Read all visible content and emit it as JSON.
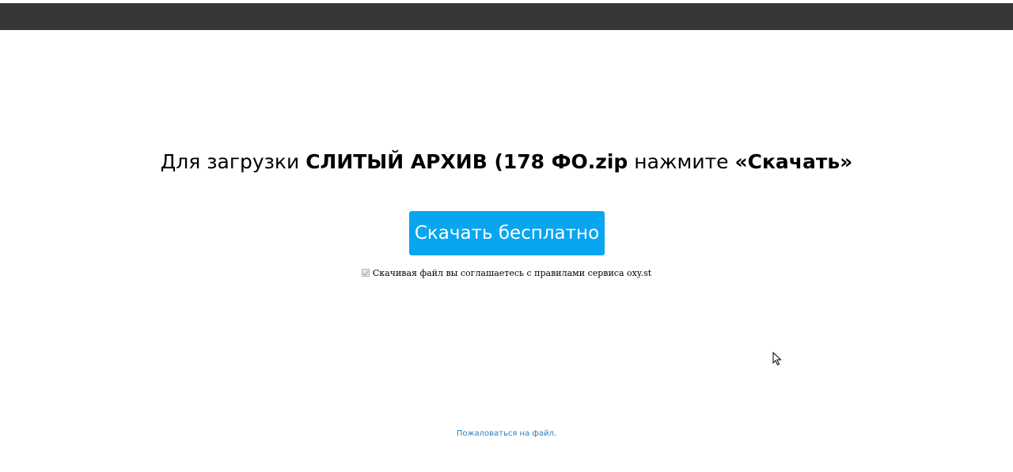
{
  "headline": {
    "prefix": "Для загрузки ",
    "filename": "СЛИТЫЙ АРХИВ (178 ФО.zip",
    "middle": " нажмите ",
    "action": "«Скачать»"
  },
  "download_button": {
    "label": "Скачать бесплатно",
    "color": "#0aa5ef"
  },
  "agreement": {
    "checked": true,
    "text": "Скачивая файл вы соглашаетесь с правилами сервиса oxy.st"
  },
  "complain_link": {
    "label": "Пожаловаться на файл."
  },
  "colors": {
    "topbar": "#373737",
    "link": "#2a7fc1"
  }
}
